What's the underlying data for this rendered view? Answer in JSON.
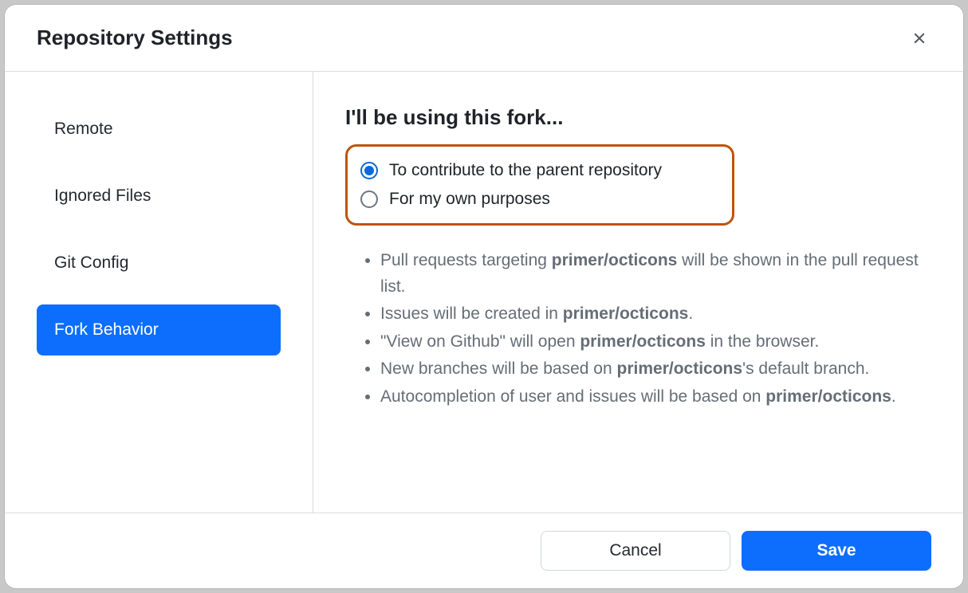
{
  "dialog": {
    "title": "Repository Settings"
  },
  "sidebar": {
    "items": [
      {
        "label": "Remote",
        "active": false
      },
      {
        "label": "Ignored Files",
        "active": false
      },
      {
        "label": "Git Config",
        "active": false
      },
      {
        "label": "Fork Behavior",
        "active": true
      }
    ]
  },
  "content": {
    "heading": "I'll be using this fork...",
    "radios": [
      {
        "label": "To contribute to the parent repository",
        "selected": true
      },
      {
        "label": "For my own purposes",
        "selected": false
      }
    ],
    "repo": "primer/octicons",
    "bullets": [
      {
        "pre": "Pull requests targeting ",
        "strong": "primer/octicons",
        "post": " will be shown in the pull request list."
      },
      {
        "pre": "Issues will be created in ",
        "strong": "primer/octicons",
        "post": "."
      },
      {
        "pre": "\"View on Github\" will open ",
        "strong": "primer/octicons",
        "post": " in the browser."
      },
      {
        "pre": "New branches will be based on ",
        "strong": "primer/octicons",
        "post": "'s default branch."
      },
      {
        "pre": "Autocompletion of user and issues will be based on ",
        "strong": "primer/octicons",
        "post": "."
      }
    ]
  },
  "footer": {
    "cancel": "Cancel",
    "save": "Save"
  },
  "colors": {
    "highlight_border": "#c0530b",
    "primary": "#0d6efd",
    "radio_selected": "#0969da"
  }
}
